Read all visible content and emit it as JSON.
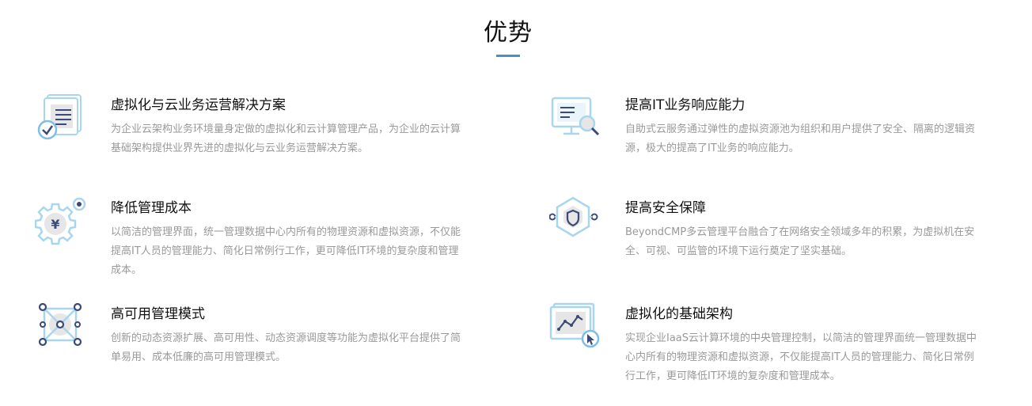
{
  "section": {
    "title": "优势"
  },
  "features": [
    {
      "icon": "document-check-icon",
      "title": "虚拟化与云业务运营解决方案",
      "description": "为企业云架构业务环境量身定做的虚拟化和云计算管理产品，为企业的云计算基础架构提供业界先进的虚拟化与云业务运营解决方案。"
    },
    {
      "icon": "monitor-search-icon",
      "title": "提高IT业务响应能力",
      "description": "自助式云服务通过弹性的虚拟资源池为组织和用户提供了安全、隔离的逻辑资源，极大的提高了IT业务的响应能力。"
    },
    {
      "icon": "gear-yen-icon",
      "title": "降低管理成本",
      "description": "以简洁的管理界面，统一管理数据中心内所有的物理资源和虚拟资源，不仅能提高IT人员的管理能力、简化日常例行工作，更可降低IT环境的复杂度和管理成本。"
    },
    {
      "icon": "hexagon-shield-icon",
      "title": "提高安全保障",
      "description": "BeyondCMP多云管理平台融合了在网络安全领域多年的积累，为虚拟机在安全、可视、可监管的环境下运行奠定了坚实基础。"
    },
    {
      "icon": "network-nodes-icon",
      "title": "高可用管理模式",
      "description": "创新的动态资源扩展、高可用性、动态资源调度等功能为虚拟化平台提供了简单易用、成本低廉的高可用管理模式。"
    },
    {
      "icon": "chart-cursor-icon",
      "title": "虚拟化的基础架构",
      "description": "实现企业IaaS云计算环境的中央管理控制，以简洁的管理界面统一管理数据中心内所有的物理资源和虚拟资源，不仅能提高IT人员的管理能力、简化日常例行工作，更可降低IT环境的复杂度和管理成本。"
    }
  ],
  "colors": {
    "accent": "#4a8fc4",
    "icon_light": "#a9d6ef",
    "icon_dark": "#3b4a78",
    "title": "#111111",
    "description": "#999999"
  }
}
